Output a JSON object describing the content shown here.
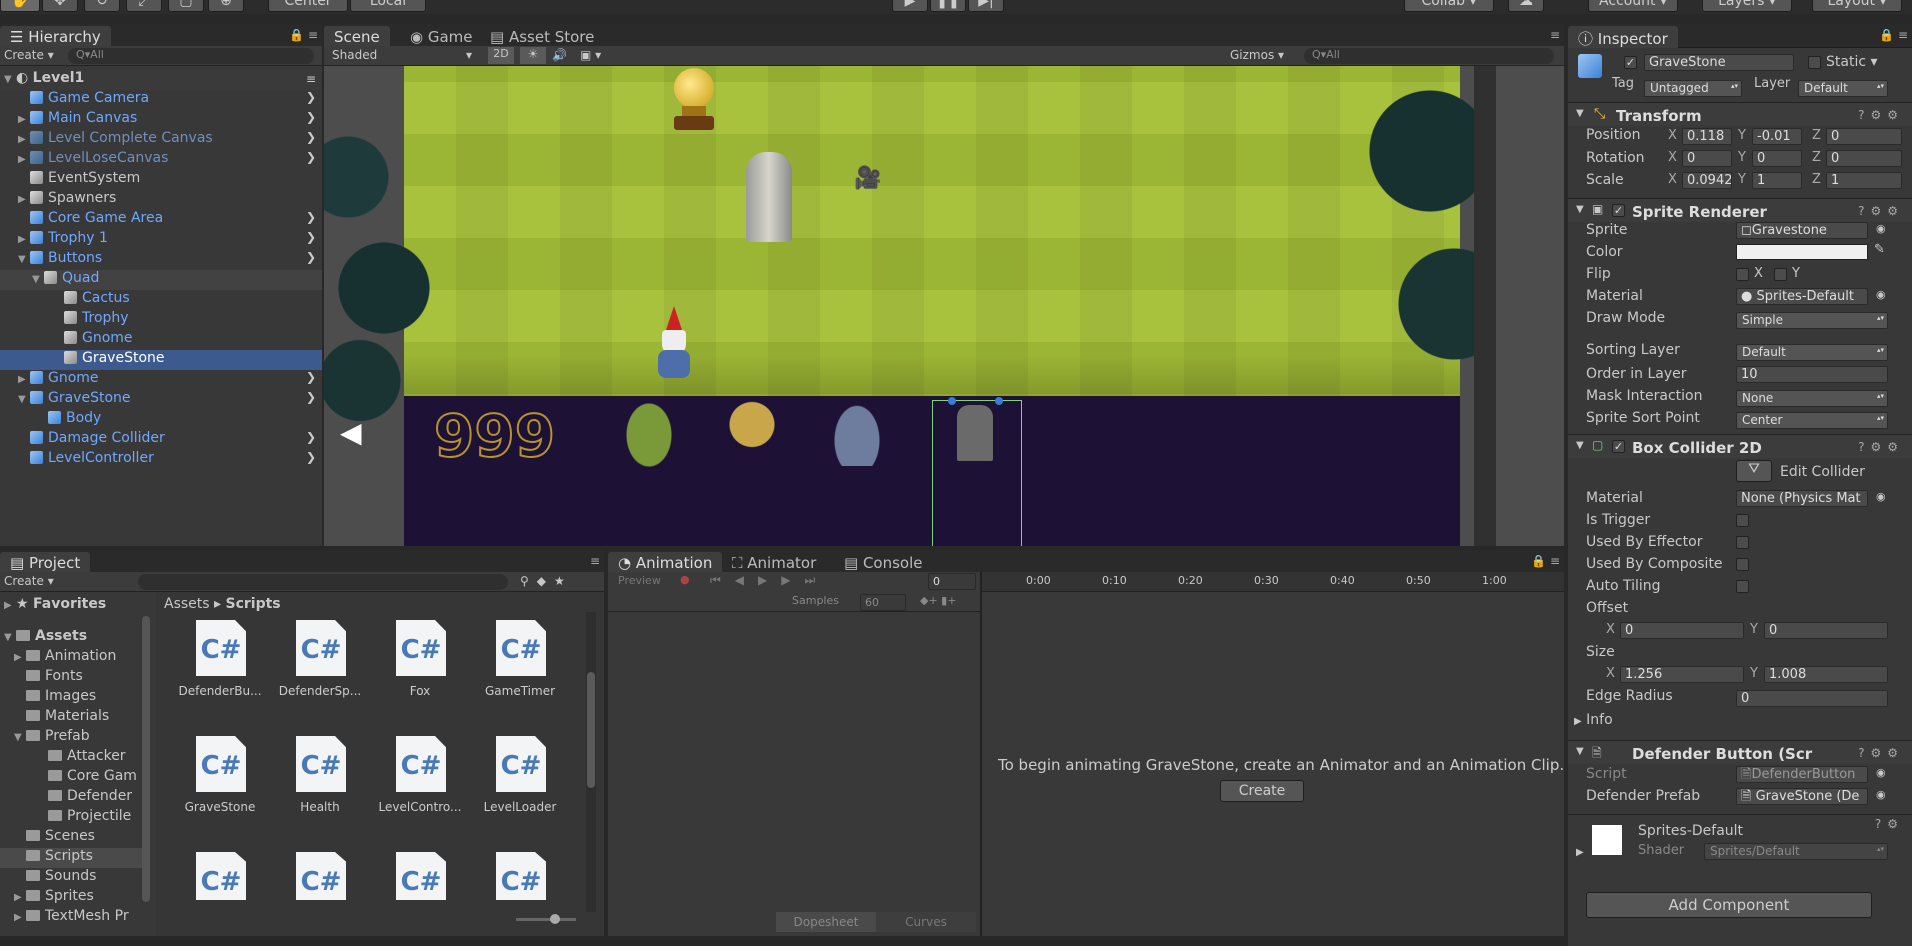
{
  "toolbar": {
    "center": "Center",
    "local": "Local",
    "collab": "Collab",
    "account": "Account",
    "layers": "Layers",
    "layout": "Layout"
  },
  "hierarchy": {
    "tab": "Hierarchy",
    "create": "Create",
    "search_placeholder": "Q▾All",
    "scene": "Level1",
    "items": [
      {
        "label": "Game Camera"
      },
      {
        "label": "Main Canvas"
      },
      {
        "label": "Level Complete Canvas"
      },
      {
        "label": "LevelLoseCanvas"
      },
      {
        "label": "EventSystem"
      },
      {
        "label": "Spawners"
      },
      {
        "label": "Core Game Area"
      },
      {
        "label": "Trophy 1"
      },
      {
        "label": "Buttons"
      },
      {
        "label": "Quad"
      },
      {
        "label": "Cactus"
      },
      {
        "label": "Trophy"
      },
      {
        "label": "Gnome"
      },
      {
        "label": "GraveStone"
      },
      {
        "label": "Gnome"
      },
      {
        "label": "GraveStone"
      },
      {
        "label": "Body"
      },
      {
        "label": "Damage Collider"
      },
      {
        "label": "LevelController"
      }
    ]
  },
  "scene": {
    "tabs": [
      "Scene",
      "Game",
      "Asset Store"
    ],
    "shaded": "Shaded",
    "mode2d": "2D",
    "gizmos": "Gizmos",
    "search_placeholder": "Q▾All",
    "score": "999"
  },
  "project": {
    "tab": "Project",
    "create": "Create",
    "favorites": "Favorites",
    "assets": "Assets",
    "tree": [
      "Animation",
      "Fonts",
      "Images",
      "Materials",
      "Prefab",
      "Attacker",
      "Core Gam",
      "Defender",
      "Projectile",
      "Scenes",
      "Scripts",
      "Sounds",
      "Sprites",
      "TextMesh Pr"
    ],
    "breadcrumb": [
      "Assets",
      "Scripts"
    ],
    "files": [
      "DefenderBu...",
      "DefenderSp...",
      "Fox",
      "GameTimer",
      "GraveStone",
      "Health",
      "LevelContro...",
      "LevelLoader"
    ],
    "cs": "C#"
  },
  "animation": {
    "tabs": [
      "Animation",
      "Animator",
      "Console"
    ],
    "preview": "Preview",
    "frame": "0",
    "samples_label": "Samples",
    "samples": "60",
    "times": [
      "0:00",
      "0:10",
      "0:20",
      "0:30",
      "0:40",
      "0:50",
      "1:00"
    ],
    "message": "To begin animating GraveStone, create an Animator and an Animation Clip.",
    "create": "Create",
    "dopesheet": "Dopesheet",
    "curves": "Curves"
  },
  "inspector": {
    "tab": "Inspector",
    "name": "GraveStone",
    "static": "Static",
    "tag_label": "Tag",
    "tag": "Untagged",
    "layer_label": "Layer",
    "layer": "Default",
    "transform": {
      "title": "Transform",
      "position_label": "Position",
      "rotation_label": "Rotation",
      "scale_label": "Scale",
      "pos": [
        "0.118",
        "-0.01",
        "0"
      ],
      "rot": [
        "0",
        "0",
        "0"
      ],
      "scale": [
        "0.0942",
        "1",
        "1"
      ]
    },
    "sprite_renderer": {
      "title": "Sprite Renderer",
      "sprite_label": "Sprite",
      "sprite": "Gravestone",
      "color_label": "Color",
      "flip_label": "Flip",
      "material_label": "Material",
      "material": "Sprites-Default",
      "draw_mode_label": "Draw Mode",
      "draw_mode": "Simple",
      "sorting_layer_label": "Sorting Layer",
      "sorting_layer": "Default",
      "order_label": "Order in Layer",
      "order": "10",
      "mask_label": "Mask Interaction",
      "mask": "None",
      "sort_point_label": "Sprite Sort Point",
      "sort_point": "Center"
    },
    "box_collider": {
      "title": "Box Collider 2D",
      "edit": "Edit Collider",
      "material_label": "Material",
      "material": "None (Physics Mat",
      "trigger": "Is Trigger",
      "effector": "Used By Effector",
      "composite": "Used By Composite",
      "tiling": "Auto Tiling",
      "offset_label": "Offset",
      "offset": [
        "0",
        "0"
      ],
      "size_label": "Size",
      "size": [
        "1.256",
        "1.008"
      ],
      "radius_label": "Edge Radius",
      "radius": "0",
      "info": "Info"
    },
    "defender": {
      "title": "Defender Button (Scr",
      "script_label": "Script",
      "script": "DefenderButton",
      "prefab_label": "Defender Prefab",
      "prefab": "GraveStone (De"
    },
    "material": {
      "name": "Sprites-Default",
      "shader_label": "Shader",
      "shader": "Sprites/Default"
    },
    "add_component": "Add Component"
  }
}
